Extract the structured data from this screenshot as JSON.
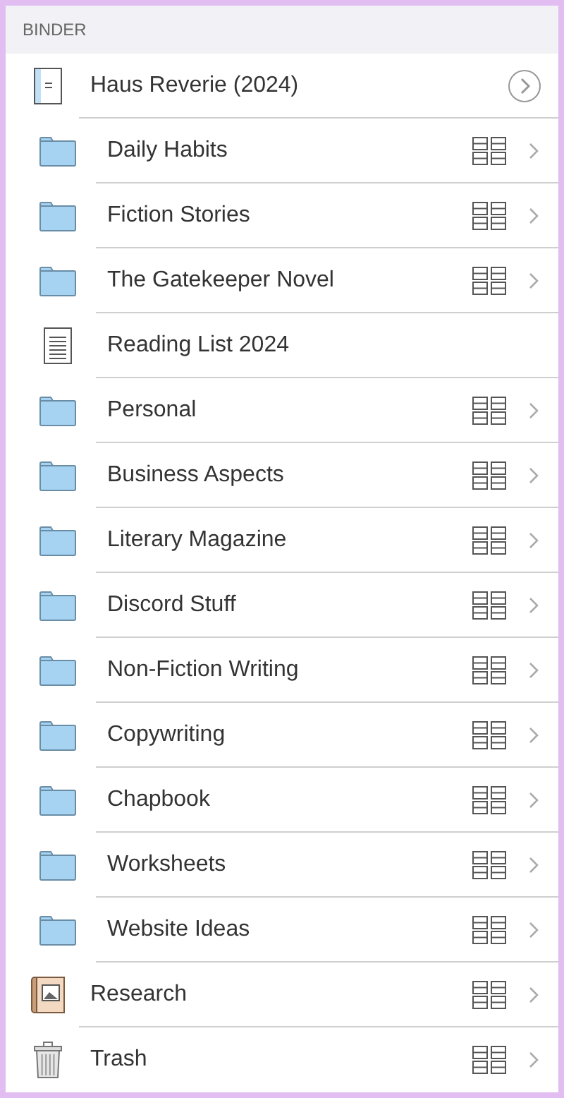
{
  "header": {
    "title": "BINDER"
  },
  "items": [
    {
      "kind": "project",
      "label": "Haus Reverie (2024)",
      "children": [
        {
          "kind": "folder",
          "label": "Daily Habits"
        },
        {
          "kind": "folder",
          "label": "Fiction Stories"
        },
        {
          "kind": "folder",
          "label": "The Gatekeeper Novel"
        },
        {
          "kind": "text",
          "label": "Reading List 2024"
        },
        {
          "kind": "folder",
          "label": "Personal"
        },
        {
          "kind": "folder",
          "label": "Business Aspects"
        },
        {
          "kind": "folder",
          "label": "Literary Magazine"
        },
        {
          "kind": "folder",
          "label": "Discord Stuff"
        },
        {
          "kind": "folder",
          "label": "Non-Fiction Writing"
        },
        {
          "kind": "folder",
          "label": "Copywriting"
        },
        {
          "kind": "folder",
          "label": "Chapbook"
        },
        {
          "kind": "folder",
          "label": "Worksheets"
        },
        {
          "kind": "folder",
          "label": "Website Ideas"
        }
      ]
    },
    {
      "kind": "research",
      "label": "Research"
    },
    {
      "kind": "trash",
      "label": "Trash"
    }
  ]
}
